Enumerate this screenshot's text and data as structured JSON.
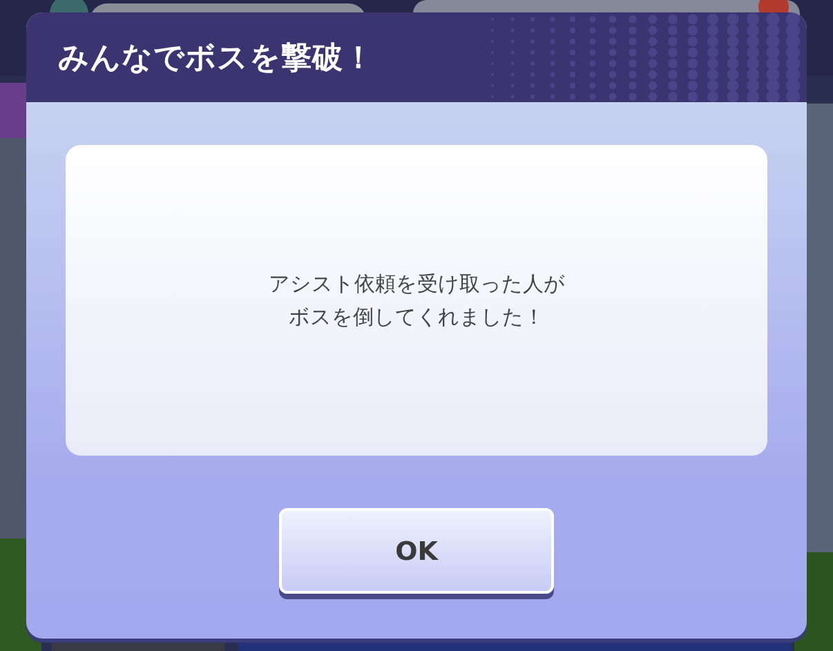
{
  "dialog": {
    "title": "みんなでボスを撃破！",
    "message_lines": [
      "アシスト依頼を受け取った人が",
      "ボスを倒してくれました！"
    ],
    "button": "OK"
  }
}
